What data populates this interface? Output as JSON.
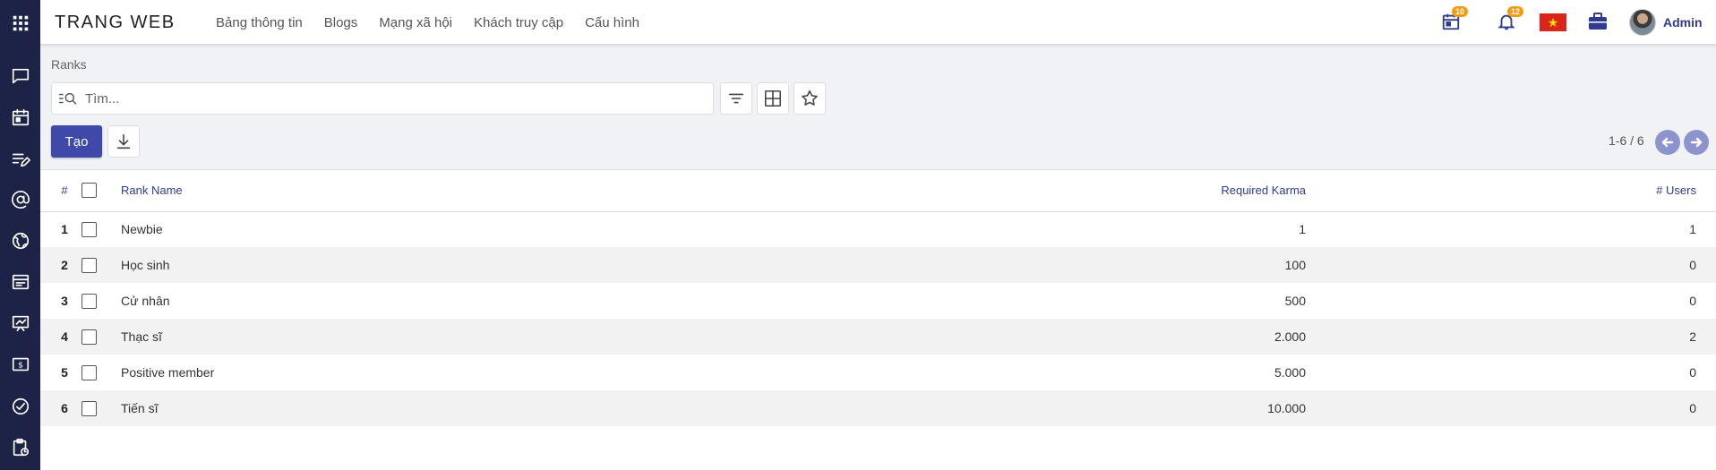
{
  "app": {
    "brand": "TRANG WEB"
  },
  "menu": {
    "items": [
      {
        "label": "Bảng thông tin"
      },
      {
        "label": "Blogs"
      },
      {
        "label": "Mạng xã hội"
      },
      {
        "label": "Khách truy cập"
      },
      {
        "label": "Cấu hình"
      }
    ]
  },
  "systray": {
    "activity_count": "10",
    "notification_count": "12",
    "language_flag": "vietnam-flag",
    "user_name": "Admin"
  },
  "sidebar": {
    "icons": [
      "apps-icon",
      "chat-icon",
      "calendar-icon",
      "notes-icon",
      "at-icon",
      "globe-icon",
      "document-icon",
      "elearning-icon",
      "money-icon",
      "check-icon",
      "clipboard-icon"
    ]
  },
  "breadcrumb": "Ranks",
  "search": {
    "placeholder": "Tìm..."
  },
  "buttons": {
    "create": "Tạo"
  },
  "pager": {
    "text": "1-6 / 6"
  },
  "table": {
    "headers": {
      "num": "#",
      "name": "Rank Name",
      "karma": "Required Karma",
      "users": "# Users"
    },
    "rows": [
      {
        "num": "1",
        "name": "Newbie",
        "karma": "1",
        "users": "1"
      },
      {
        "num": "2",
        "name": "Học sinh",
        "karma": "100",
        "users": "0"
      },
      {
        "num": "3",
        "name": "Cử nhân",
        "karma": "500",
        "users": "0"
      },
      {
        "num": "4",
        "name": "Thạc sĩ",
        "karma": "2.000",
        "users": "2"
      },
      {
        "num": "5",
        "name": "Positive member",
        "karma": "5.000",
        "users": "0"
      },
      {
        "num": "6",
        "name": "Tiến sĩ",
        "karma": "10.000",
        "users": "0"
      }
    ]
  },
  "colors": {
    "sidebar": "#1d2247",
    "primary": "#3f4aa8",
    "header_text": "#2e3b8e",
    "badge": "#f39c12"
  }
}
